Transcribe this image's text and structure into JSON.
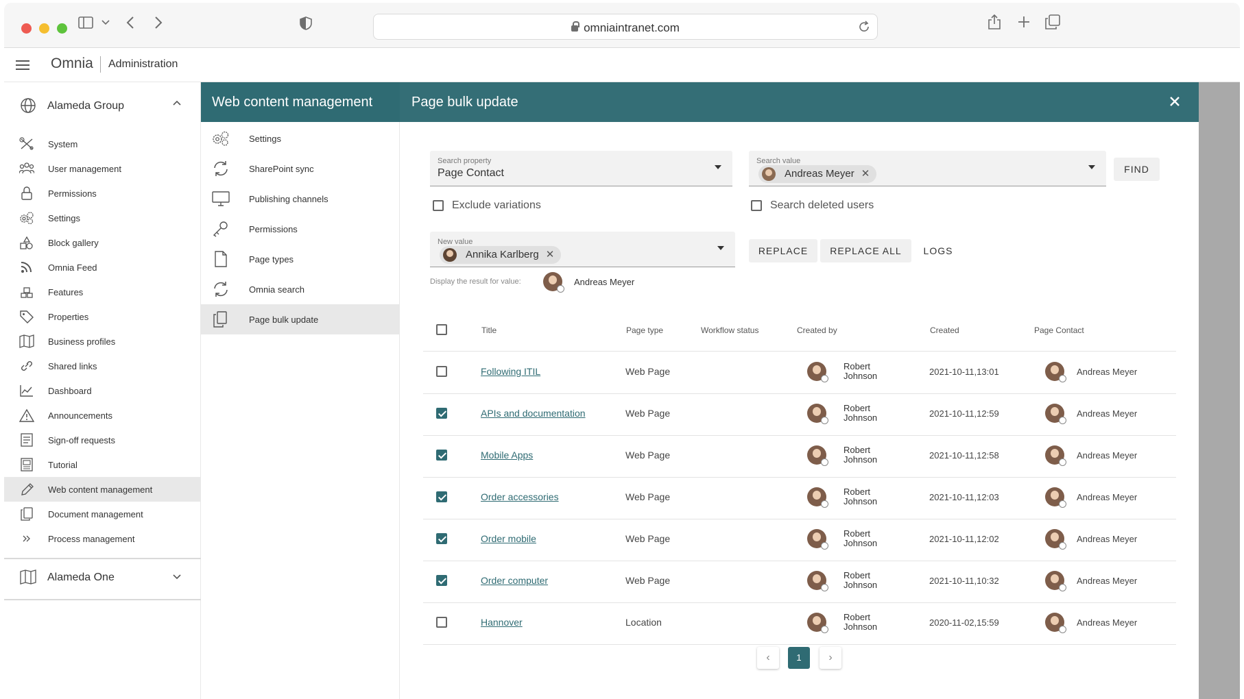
{
  "browser": {
    "url": "omniaintranet.com"
  },
  "app": {
    "brand": "Omnia",
    "section": "Administration"
  },
  "nav": {
    "group1": "Alameda Group",
    "items": [
      {
        "label": "System",
        "icon": "tools-icon"
      },
      {
        "label": "User management",
        "icon": "users-icon"
      },
      {
        "label": "Permissions",
        "icon": "lock-icon"
      },
      {
        "label": "Settings",
        "icon": "gears-icon"
      },
      {
        "label": "Block gallery",
        "icon": "blocks-icon"
      },
      {
        "label": "Omnia Feed",
        "icon": "rss-icon"
      },
      {
        "label": "Features",
        "icon": "features-icon"
      },
      {
        "label": "Properties",
        "icon": "tag-icon"
      },
      {
        "label": "Business profiles",
        "icon": "map-icon"
      },
      {
        "label": "Shared links",
        "icon": "link-icon"
      },
      {
        "label": "Dashboard",
        "icon": "chart-icon"
      },
      {
        "label": "Announcements",
        "icon": "warning-icon"
      },
      {
        "label": "Sign-off requests",
        "icon": "list-icon"
      },
      {
        "label": "Tutorial",
        "icon": "book-icon"
      },
      {
        "label": "Web content management",
        "icon": "pencil-icon"
      },
      {
        "label": "Document management",
        "icon": "copy-icon"
      },
      {
        "label": "Process management",
        "icon": "double-chevron-icon"
      }
    ],
    "group2": "Alameda One"
  },
  "wcm": {
    "title": "Web content management",
    "items": [
      {
        "label": "Settings",
        "icon": "gears-icon"
      },
      {
        "label": "SharePoint sync",
        "icon": "sync-icon"
      },
      {
        "label": "Publishing channels",
        "icon": "monitor-icon"
      },
      {
        "label": "Permissions",
        "icon": "key-icon"
      },
      {
        "label": "Page types",
        "icon": "page-icon"
      },
      {
        "label": "Omnia search",
        "icon": "sync-icon"
      },
      {
        "label": "Page bulk update",
        "icon": "copy-icon"
      }
    ]
  },
  "main": {
    "title": "Page bulk update",
    "search_property_label": "Search property",
    "search_property_value": "Page Contact",
    "search_value_label": "Search value",
    "search_value_chip": "Andreas Meyer",
    "find": "FIND",
    "exclude_variations": "Exclude variations",
    "search_deleted_users": "Search deleted users",
    "new_value_label": "New value",
    "new_value_chip": "Annika Karlberg",
    "replace": "REPLACE",
    "replace_all": "REPLACE ALL",
    "logs": "LOGS",
    "display_label": "Display the result for value:",
    "display_value": "Andreas Meyer",
    "columns": [
      "Title",
      "Page type",
      "Workflow status",
      "Created by",
      "Created",
      "Page Contact"
    ],
    "rows": [
      {
        "checked": false,
        "title": "Following ITIL",
        "type": "Web Page",
        "status": "",
        "creator_first": "Robert",
        "creator_last": "Johnson",
        "created": "2021-10-11,13:01",
        "contact": "Andreas Meyer"
      },
      {
        "checked": true,
        "title": "APIs and documentation",
        "type": "Web Page",
        "status": "",
        "creator_first": "Robert",
        "creator_last": "Johnson",
        "created": "2021-10-11,12:59",
        "contact": "Andreas Meyer"
      },
      {
        "checked": true,
        "title": "Mobile Apps",
        "type": "Web Page",
        "status": "",
        "creator_first": "Robert",
        "creator_last": "Johnson",
        "created": "2021-10-11,12:58",
        "contact": "Andreas Meyer"
      },
      {
        "checked": true,
        "title": "Order accessories",
        "type": "Web Page",
        "status": "",
        "creator_first": "Robert",
        "creator_last": "Johnson",
        "created": "2021-10-11,12:03",
        "contact": "Andreas Meyer"
      },
      {
        "checked": true,
        "title": "Order mobile",
        "type": "Web Page",
        "status": "",
        "creator_first": "Robert",
        "creator_last": "Johnson",
        "created": "2021-10-11,12:02",
        "contact": "Andreas Meyer"
      },
      {
        "checked": true,
        "title": "Order computer",
        "type": "Web Page",
        "status": "",
        "creator_first": "Robert",
        "creator_last": "Johnson",
        "created": "2021-10-11,10:32",
        "contact": "Andreas Meyer"
      },
      {
        "checked": false,
        "title": "Hannover",
        "type": "Location",
        "status": "",
        "creator_first": "Robert",
        "creator_last": "Johnson",
        "created": "2020-11-02,15:59",
        "contact": "Andreas Meyer"
      }
    ],
    "pagination": {
      "current": "1"
    }
  },
  "colors": {
    "teal": "#2f6b73",
    "teal_header": "#346e76",
    "active_bg": "#e8e8e8"
  }
}
